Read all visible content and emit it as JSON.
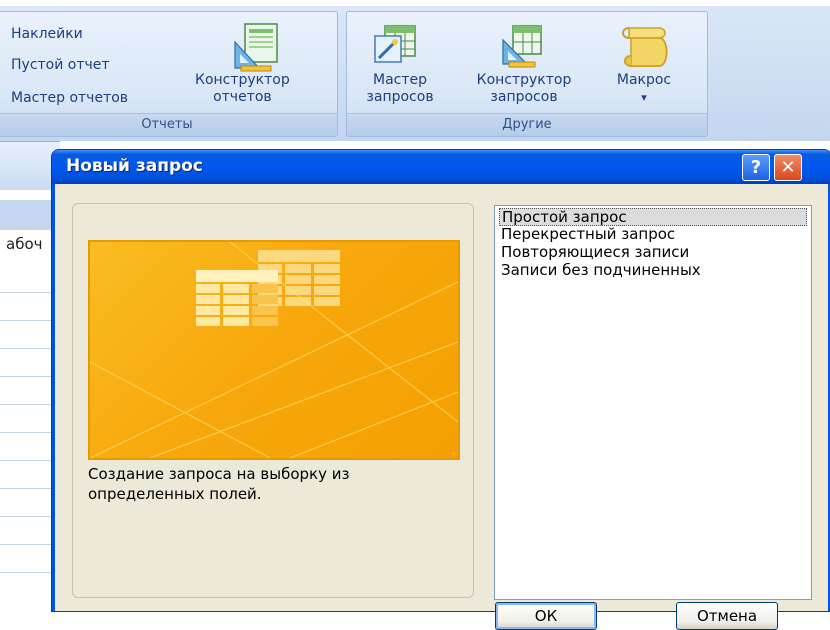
{
  "ribbon": {
    "reports_group": {
      "label": "Отчеты",
      "items": [
        "Наклейки",
        "Пустой отчет",
        "Мастер отчетов"
      ],
      "designer_line1": "Конструктор",
      "designer_line2": "отчетов"
    },
    "other_group": {
      "label": "Другие",
      "query_wizard_line1": "Мастер",
      "query_wizard_line2": "запросов",
      "query_designer_line1": "Конструктор",
      "query_designer_line2": "запросов",
      "macro_label": "Макрос",
      "macro_arrow": "▾"
    }
  },
  "background": {
    "cell_fragment": "абоч"
  },
  "dialog": {
    "title": "Новый запрос",
    "help_glyph": "?",
    "close_glyph": "✕",
    "description": "Создание запроса на выборку из определенных полей.",
    "options": [
      "Простой запрос",
      "Перекрестный запрос",
      "Повторяющиеся записи",
      "Записи без подчиненных"
    ],
    "selected_index": 0,
    "ok_label": "ОК",
    "cancel_label": "Отмена"
  },
  "colors": {
    "titlebar": "#0058ee",
    "preview_orange": "#f7a70c",
    "ribbon_text": "#1d3f7a"
  }
}
